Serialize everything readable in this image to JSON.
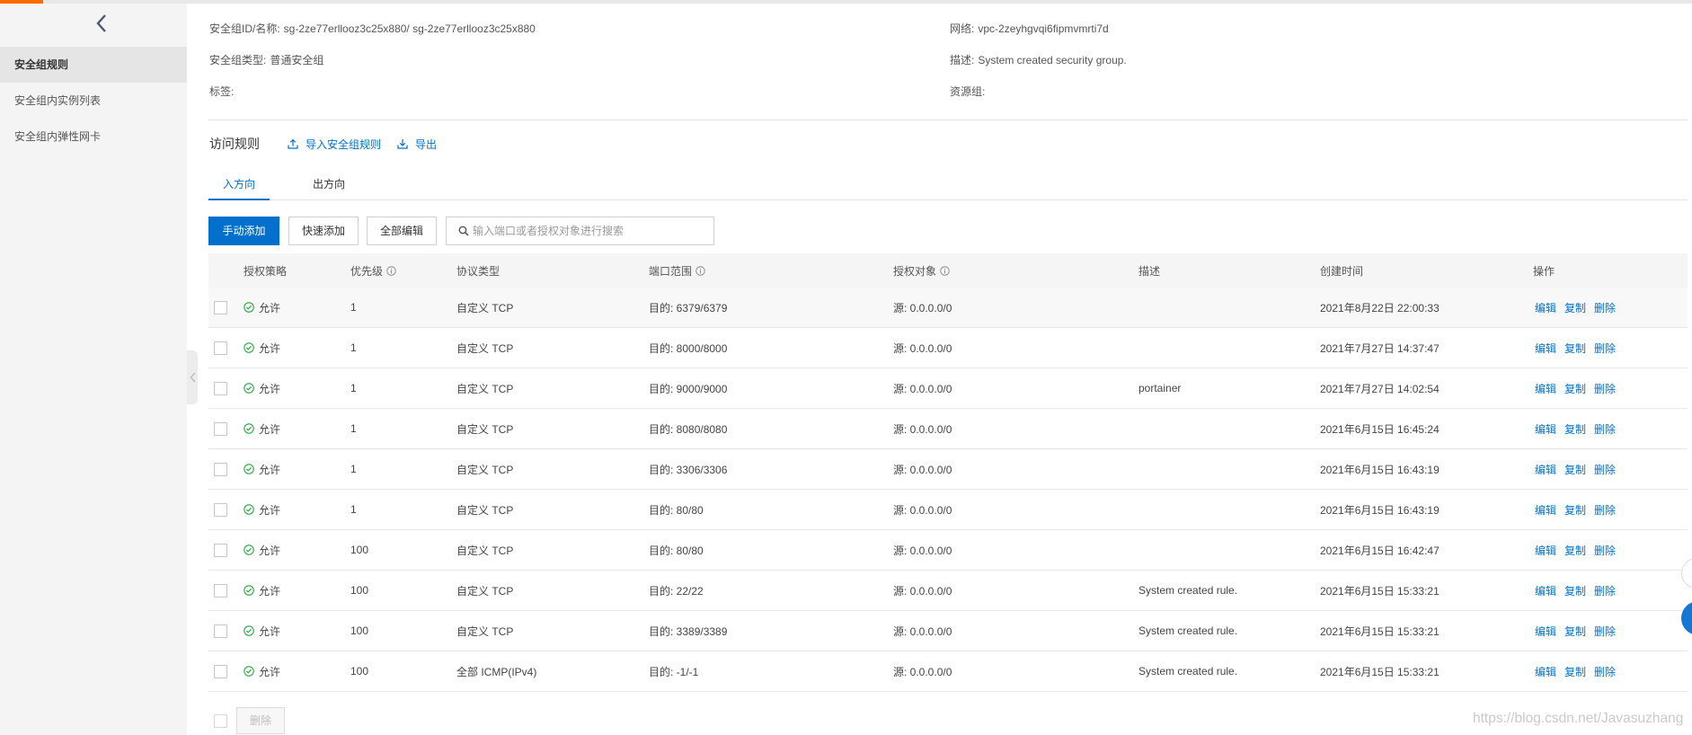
{
  "colors": {
    "accent": "#0070cc",
    "brand_orange": "#ff6a00",
    "success": "#2aa745",
    "sidebar_bg": "#f4f4f4",
    "sidebar_active_bg": "#e5e5e5",
    "float_blue": "#1677d2"
  },
  "sidebar": {
    "back_icon": "chevron-left-icon",
    "collapse_icon": "chevron-left-icon",
    "items": [
      {
        "label": "安全组规则",
        "active": true
      },
      {
        "label": "安全组内实例列表",
        "active": false
      },
      {
        "label": "安全组内弹性网卡",
        "active": false
      }
    ]
  },
  "info": {
    "id_name": {
      "label": "安全组ID/名称:",
      "value": "sg-2ze77erllooz3c25x880/ sg-2ze77erllooz3c25x880"
    },
    "group_type": {
      "label": "安全组类型:",
      "value": "普通安全组"
    },
    "tags": {
      "label": "标签:"
    },
    "network": {
      "label": "网络:",
      "value": "vpc-2zeyhgvqi6fipmvmrti7d"
    },
    "description": {
      "label": "描述:",
      "value": "System created security group."
    },
    "resource_group": {
      "label": "资源组:"
    }
  },
  "access_rules": {
    "title": "访问规则",
    "import_label": "导入安全组规则",
    "import_icon": "upload-icon",
    "export_label": "导出",
    "export_icon": "download-icon"
  },
  "tabs": [
    {
      "label": "入方向",
      "active": true
    },
    {
      "label": "出方向",
      "active": false
    }
  ],
  "toolbar": {
    "manual_add_label": "手动添加",
    "quick_add_label": "快速添加",
    "edit_all_label": "全部编辑",
    "search": {
      "placeholder": "输入端口或者授权对象进行搜索",
      "value": "",
      "icon": "search-icon"
    }
  },
  "table": {
    "columns": [
      {
        "label": "授权策略"
      },
      {
        "label": "优先级",
        "icon": "info-icon"
      },
      {
        "label": "协议类型"
      },
      {
        "label": "端口范围",
        "icon": "info-icon"
      },
      {
        "label": "授权对象",
        "icon": "info-icon"
      },
      {
        "label": "描述"
      },
      {
        "label": "创建时间"
      },
      {
        "label": "操作"
      }
    ],
    "policy_icon": "check-circle-icon",
    "actions": [
      "编辑",
      "复制",
      "删除"
    ],
    "rows": [
      {
        "policy": "允许",
        "priority": "1",
        "protocol": "自定义 TCP",
        "port_range": "目的: 6379/6379",
        "auth_object": "源: 0.0.0.0/0",
        "created": "2021年8月22日 22:00:33"
      },
      {
        "policy": "允许",
        "priority": "1",
        "protocol": "自定义 TCP",
        "port_range": "目的: 8000/8000",
        "auth_object": "源: 0.0.0.0/0",
        "created": "2021年7月27日 14:37:47"
      },
      {
        "policy": "允许",
        "priority": "1",
        "protocol": "自定义 TCP",
        "port_range": "目的: 9000/9000",
        "auth_object": "源: 0.0.0.0/0",
        "description": "portainer",
        "created": "2021年7月27日 14:02:54"
      },
      {
        "policy": "允许",
        "priority": "1",
        "protocol": "自定义 TCP",
        "port_range": "目的: 8080/8080",
        "auth_object": "源: 0.0.0.0/0",
        "created": "2021年6月15日 16:45:24"
      },
      {
        "policy": "允许",
        "priority": "1",
        "protocol": "自定义 TCP",
        "port_range": "目的: 3306/3306",
        "auth_object": "源: 0.0.0.0/0",
        "created": "2021年6月15日 16:43:19"
      },
      {
        "policy": "允许",
        "priority": "1",
        "protocol": "自定义 TCP",
        "port_range": "目的: 80/80",
        "auth_object": "源: 0.0.0.0/0",
        "created": "2021年6月15日 16:43:19"
      },
      {
        "policy": "允许",
        "priority": "100",
        "protocol": "自定义 TCP",
        "port_range": "目的: 80/80",
        "auth_object": "源: 0.0.0.0/0",
        "created": "2021年6月15日 16:42:47"
      },
      {
        "policy": "允许",
        "priority": "100",
        "protocol": "自定义 TCP",
        "port_range": "目的: 22/22",
        "auth_object": "源: 0.0.0.0/0",
        "description": "System created rule.",
        "created": "2021年6月15日 15:33:21"
      },
      {
        "policy": "允许",
        "priority": "100",
        "protocol": "自定义 TCP",
        "port_range": "目的: 3389/3389",
        "auth_object": "源: 0.0.0.0/0",
        "description": "System created rule.",
        "created": "2021年6月15日 15:33:21"
      },
      {
        "policy": "允许",
        "priority": "100",
        "protocol": "全部 ICMP(IPv4)",
        "port_range": "目的: -1/-1",
        "auth_object": "源: 0.0.0.0/0",
        "description": "System created rule.",
        "created": "2021年6月15日 15:33:21"
      }
    ]
  },
  "footer": {
    "delete_label": "删除",
    "delete_disabled": true
  },
  "watermark": "https://blog.csdn.net/Javasuzhang"
}
